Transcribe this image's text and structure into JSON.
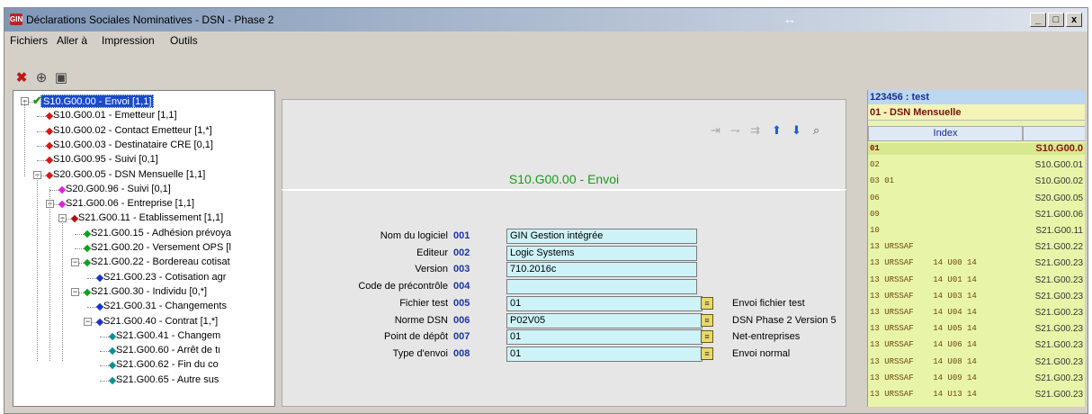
{
  "window": {
    "title": "Déclarations Sociales Nominatives - DSN - Phase 2",
    "app_icon_text": "GIN",
    "resize_glyph": "↔",
    "min_label": "_",
    "max_label": "□",
    "close_label": "x"
  },
  "menu": [
    "Fichiers",
    "Aller à",
    "Impression",
    "Outils"
  ],
  "toolbar": {
    "icons": [
      "delete-icon",
      "lock-icon",
      "screen-icon"
    ],
    "delete_glyph": "✖",
    "lock_glyph": "⊕",
    "screen_glyph": "▣"
  },
  "tree": [
    {
      "label": "S10.G00.00 - Envoi [1,1]",
      "selected": true,
      "marker": "check"
    },
    {
      "label": "S10.G00.01 - Emetteur [1,1]",
      "marker": "red"
    },
    {
      "label": "S10.G00.02 - Contact Emetteur [1,*]",
      "marker": "red"
    },
    {
      "label": "S10.G00.03 - Destinataire CRE [0,1]",
      "marker": "red"
    },
    {
      "label": "S10.G00.95 - Suivi [0,1]",
      "marker": "red"
    },
    {
      "label": "S20.G00.05 - DSN Mensuelle [1,1]",
      "marker": "red"
    },
    {
      "label": "S20.G00.96 - Suivi [0,1]",
      "marker": "magenta"
    },
    {
      "label": "S21.G00.06 - Entreprise [1,1]",
      "marker": "magenta"
    },
    {
      "label": "S21.G00.11 - Etablissement [1,1]",
      "marker": "darkred"
    },
    {
      "label": "S21.G00.15 - Adhésion prévoya",
      "marker": "green"
    },
    {
      "label": "S21.G00.20 - Versement OPS [l",
      "marker": "green"
    },
    {
      "label": "S21.G00.22 - Bordereau cotisat",
      "marker": "green"
    },
    {
      "label": "S21.G00.23 - Cotisation agr",
      "marker": "blue"
    },
    {
      "label": "S21.G00.30 - Individu [0,*]",
      "marker": "green"
    },
    {
      "label": "S21.G00.31 - Changements",
      "marker": "blue"
    },
    {
      "label": "S21.G00.40 - Contrat [1,*]",
      "marker": "blue"
    },
    {
      "label": "S21.G00.41 - Changem",
      "marker": "teal"
    },
    {
      "label": "S21.G00.60 - Arrêt de tı",
      "marker": "teal"
    },
    {
      "label": "S21.G00.62 - Fin du co",
      "marker": "teal"
    },
    {
      "label": "S21.G00.65 - Autre sus",
      "marker": "teal"
    }
  ],
  "detail": {
    "title": "S10.G00.00 - Envoi",
    "nav_glyphs": [
      "⇥",
      "⇁",
      "⇉",
      "⬆",
      "⬇",
      "⌕"
    ],
    "fields": [
      {
        "label": "Nom du logiciel",
        "code": "001",
        "value": "GIN Gestion intégrée",
        "lookup": false,
        "desc": ""
      },
      {
        "label": "Editeur",
        "code": "002",
        "value": "Logic Systems",
        "lookup": false,
        "desc": ""
      },
      {
        "label": "Version",
        "code": "003",
        "value": "710.2016c",
        "lookup": false,
        "desc": ""
      },
      {
        "label": "Code de précontrôle",
        "code": "004",
        "value": "",
        "lookup": false,
        "desc": ""
      },
      {
        "label": "Fichier test",
        "code": "005",
        "value": "01",
        "lookup": true,
        "desc": "Envoi fichier test"
      },
      {
        "label": "Norme DSN",
        "code": "006",
        "value": "P02V05",
        "lookup": true,
        "desc": "DSN Phase 2 Version 5"
      },
      {
        "label": "Point de dépôt",
        "code": "007",
        "value": "01",
        "lookup": true,
        "desc": "Net-entreprises"
      },
      {
        "label": "Type d'envoi",
        "code": "008",
        "value": "01",
        "lookup": true,
        "desc": "Envoi normal"
      }
    ]
  },
  "right_panel": {
    "header1": "123456 : test",
    "header2": "01 - DSN Mensuelle",
    "column": "Index",
    "rows": [
      {
        "index": "01",
        "code": "S10.G00.0"
      },
      {
        "index": "02",
        "code": "S10.G00.01"
      },
      {
        "index": "03 01",
        "code": "S10.G00.02"
      },
      {
        "index": "06",
        "code": "S20.G00.05"
      },
      {
        "index": "09",
        "code": "S21.G00.06"
      },
      {
        "index": "10",
        "code": "S21.G00.11"
      },
      {
        "index": "13 URSSAF",
        "code": "S21.G00.22"
      },
      {
        "index": "13 URSSAF    14 U00 14",
        "code": "S21.G00.23"
      },
      {
        "index": "13 URSSAF    14 U01 14",
        "code": "S21.G00.23"
      },
      {
        "index": "13 URSSAF    14 U03 14",
        "code": "S21.G00.23"
      },
      {
        "index": "13 URSSAF    14 U04 14",
        "code": "S21.G00.23"
      },
      {
        "index": "13 URSSAF    14 U05 14",
        "code": "S21.G00.23"
      },
      {
        "index": "13 URSSAF    14 U06 14",
        "code": "S21.G00.23"
      },
      {
        "index": "13 URSSAF    14 U08 14",
        "code": "S21.G00.23"
      },
      {
        "index": "13 URSSAF    14 U09 14",
        "code": "S21.G00.23"
      },
      {
        "index": "13 URSSAF    14 U13 14",
        "code": "S21.G00.23"
      }
    ]
  }
}
